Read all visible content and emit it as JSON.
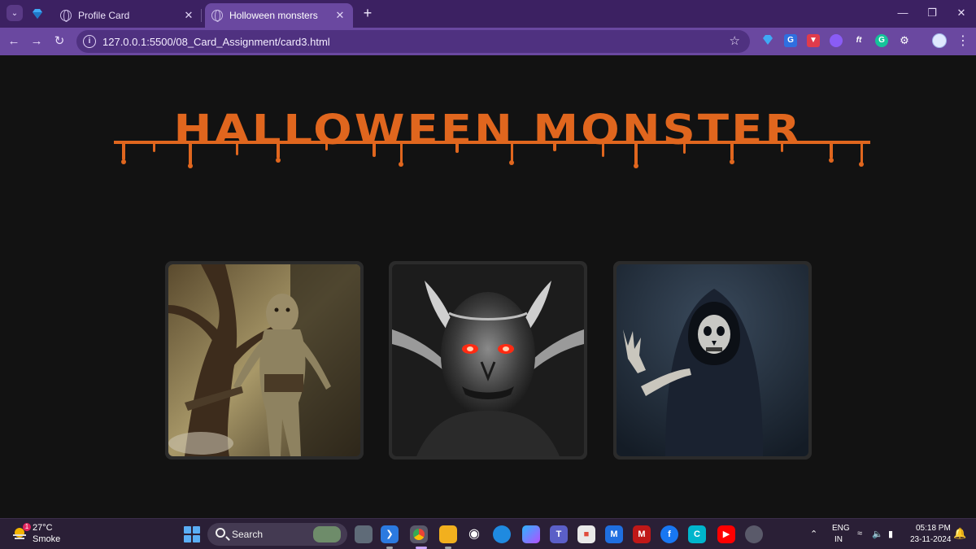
{
  "browser": {
    "tabs": [
      {
        "title": "Profile Card",
        "active": false
      },
      {
        "title": "Holloween monsters",
        "active": true
      }
    ],
    "url": "127.0.0.1:5500/08_Card_Assignment/card3.html"
  },
  "page": {
    "heading": "HALLOWEEN MONSTER",
    "heading_color": "#e0661e",
    "cards": [
      {
        "image": "goblin-in-forest"
      },
      {
        "image": "horned-demon-red-eyes"
      },
      {
        "image": "grim-reaper-hooded"
      }
    ]
  },
  "taskbar": {
    "weather": {
      "temperature": "27°C",
      "condition": "Smoke",
      "badge": "1"
    },
    "search_label": "Search",
    "language": {
      "line1": "ENG",
      "line2": "IN"
    },
    "clock": {
      "time": "05:18 PM",
      "date": "23-11-2024"
    }
  },
  "colors": {
    "tabstrip": "#3c2162",
    "toolbar": "#6a48a0",
    "page_bg": "#121212",
    "card_frame": "#2b2b2b"
  }
}
